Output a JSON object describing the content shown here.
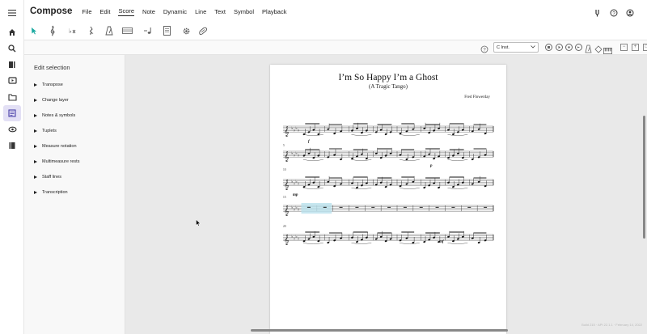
{
  "app": {
    "title": "Compose"
  },
  "menu": [
    "File",
    "Edit",
    "Score",
    "Note",
    "Dynamic",
    "Line",
    "Text",
    "Symbol",
    "Playback"
  ],
  "menu_active": "Score",
  "rail_icons": [
    "hamburger-icon",
    "home-icon",
    "search-icon",
    "library-icon",
    "video-icon",
    "folder-icon",
    "score-icon",
    "view-icon",
    "book-icon"
  ],
  "toolbar_icons": [
    "pointer-icon",
    "treble-clef-icon",
    "quarter-rest-icon",
    "eighth-rest-icon",
    "metronome-icon",
    "keyboard-icon",
    "note-duration-icon",
    "text-page-icon",
    "settings-icon",
    "link-icon"
  ],
  "scorebar": {
    "instrument": "C Inst."
  },
  "panel": {
    "title": "Edit selection",
    "sections": [
      "Transpose",
      "Change layer",
      "Notes & symbols",
      "Tuplets",
      "Measure notation",
      "Multimeasure rests",
      "Staff lines",
      "Transcription"
    ]
  },
  "score": {
    "title": "I’m So Happy I’m a Ghost",
    "subtitle": "(A Tragic Tango)",
    "composer": "Fred Flowerday",
    "measure_numbers": [
      "5",
      "10",
      "15",
      "20"
    ],
    "dynamics": [
      "f",
      "p",
      "mp",
      "mf"
    ]
  },
  "build_info": "Build 215 · API 22.1.1 · February 14, 2022"
}
